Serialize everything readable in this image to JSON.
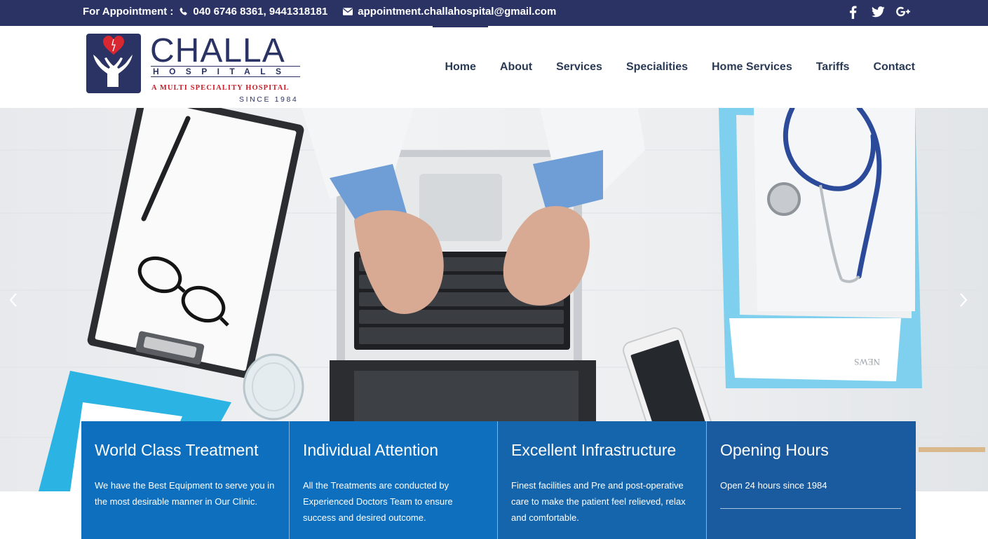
{
  "topbar": {
    "appointment_label": "For Appointment :",
    "phones": "040 6746 8361,  9441318181",
    "email": "appointment.challahospital@gmail.com",
    "social": [
      "facebook-icon",
      "twitter-icon",
      "google-plus-icon"
    ]
  },
  "logo": {
    "name": "CHALLA",
    "sub": "HOSPITALS",
    "tagline": "A MULTI  SPECIALITY HOSPITAL",
    "since": "SINCE 1984"
  },
  "nav": {
    "items": [
      "Home",
      "About",
      "Services",
      "Specialities",
      "Home Services",
      "Tariffs",
      "Contact"
    ],
    "active": "Home"
  },
  "hero": {
    "prev_icon": "chevron-left-icon",
    "next_icon": "chevron-right-icon",
    "newspaper_text": "NEWS"
  },
  "features": [
    {
      "title": "World Class Treatment",
      "text": "We have the Best Equipment to serve you in the most desirable manner in Our Clinic."
    },
    {
      "title": "Individual Attention",
      "text": "All the Treatments are conducted by Experienced Doctors Team to ensure success and desired outcome."
    },
    {
      "title": "Excellent Infrastructure",
      "text": "Finest facilities and Pre and post-operative care to make the patient feel relieved, relax and comfortable."
    },
    {
      "title": "Opening Hours",
      "text": "Open 24 hours since 1984"
    }
  ],
  "colors": {
    "brand_navy": "#2a3363",
    "brand_red": "#c8202b",
    "feature_blue": "#0d6fbd"
  }
}
